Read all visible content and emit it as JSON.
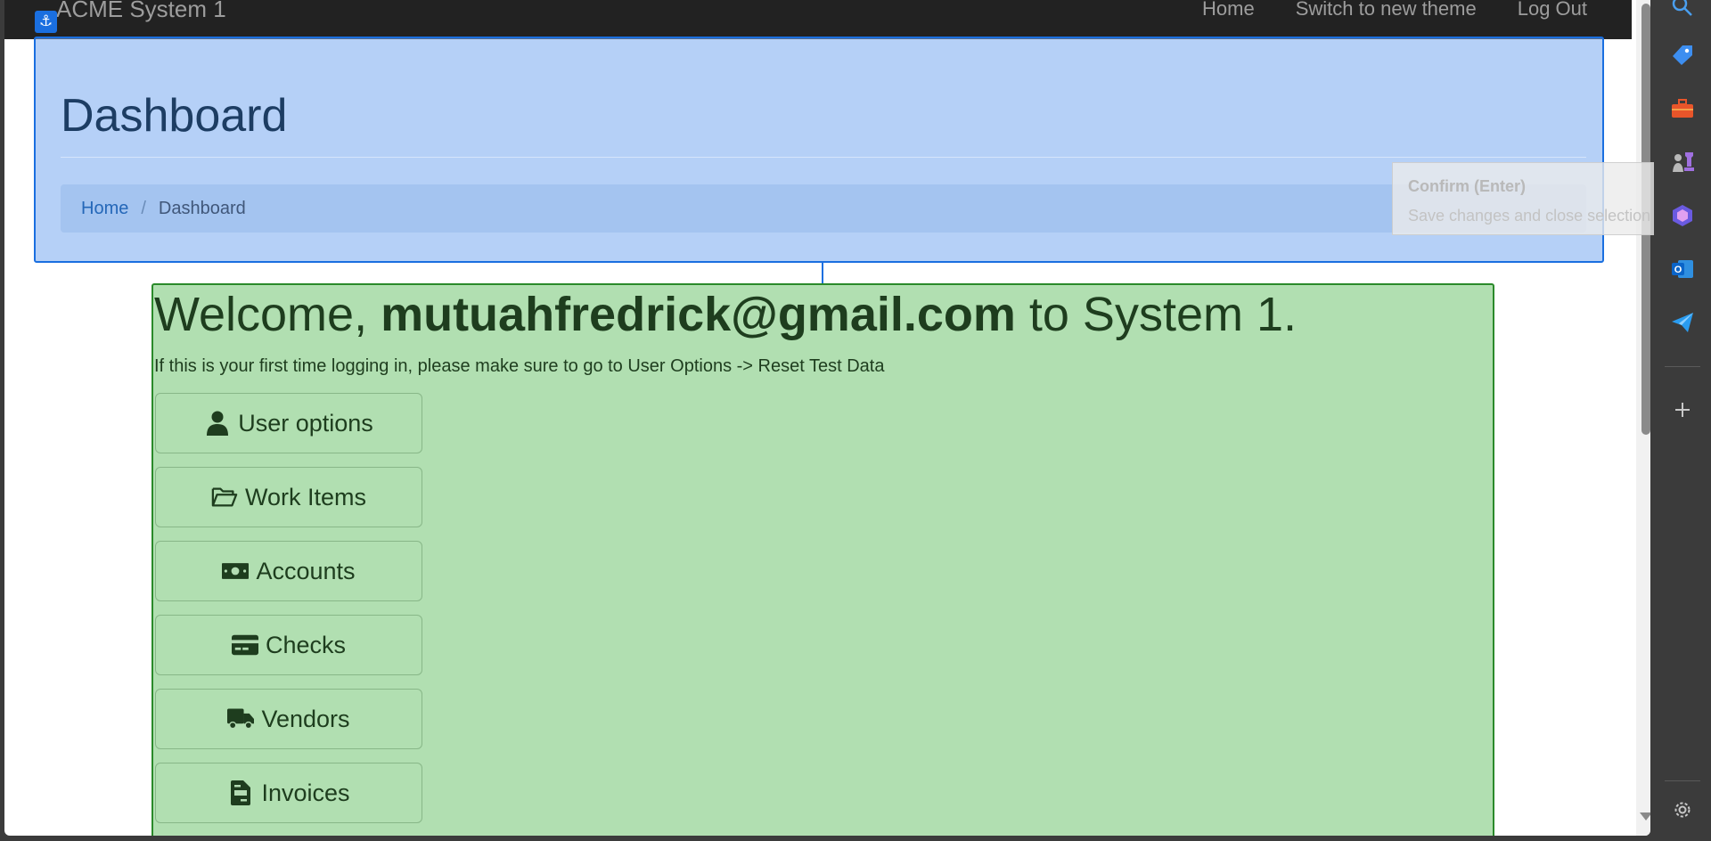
{
  "navbar": {
    "brand": "ACME System 1",
    "links": [
      "Home",
      "Switch to new theme",
      "Log Out"
    ]
  },
  "header": {
    "title": "Dashboard",
    "breadcrumb": {
      "home": "Home",
      "separator": "/",
      "current": "Dashboard"
    }
  },
  "welcome": {
    "prefix": "Welcome, ",
    "email": "mutuahfredrick@gmail.com",
    "suffix": " to System 1.",
    "notice": "If this is your first time logging in, please make sure to go to User Options -> Reset Test Data"
  },
  "menu": [
    {
      "label": "User options",
      "icon": "user-icon"
    },
    {
      "label": "Work Items",
      "icon": "folder-open-icon"
    },
    {
      "label": "Accounts",
      "icon": "money-bill-icon"
    },
    {
      "label": "Checks",
      "icon": "credit-card-icon"
    },
    {
      "label": "Vendors",
      "icon": "truck-icon"
    },
    {
      "label": "Invoices",
      "icon": "file-invoice-icon"
    }
  ],
  "tooltip": {
    "title": "Confirm (Enter)",
    "text": "Save changes and close selection wizard"
  },
  "colors": {
    "header_highlight": "#78aaf0",
    "content_highlight": "#78c878",
    "navbar": "#222222"
  }
}
